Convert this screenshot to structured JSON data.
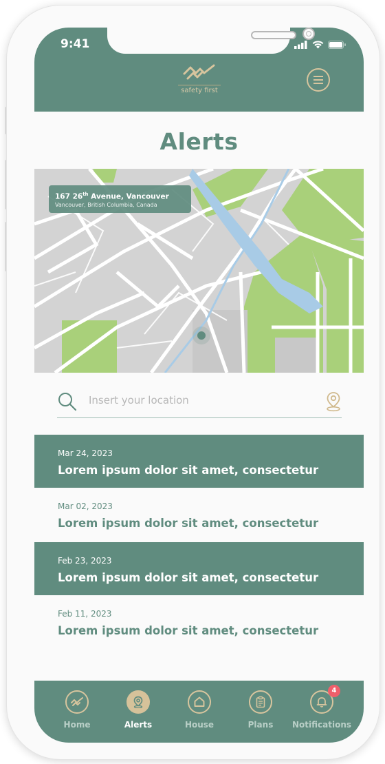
{
  "status_bar": {
    "time": "9:41"
  },
  "header": {
    "logo_text": "safety first"
  },
  "page": {
    "title": "Alerts"
  },
  "map": {
    "address_line1": "167 26",
    "address_sup": "th",
    "address_line1_rest": " Avenue, Vancouver",
    "address_line2": "Vancouver, British Columbia, Canada"
  },
  "search": {
    "placeholder": "Insert your location",
    "value": ""
  },
  "alerts": [
    {
      "date": "Mar 24, 2023",
      "title": "Lorem ipsum dolor sit amet, consectetur",
      "style": "dark"
    },
    {
      "date": "Mar 02, 2023",
      "title": "Lorem ipsum dolor sit amet, consectetur",
      "style": "light"
    },
    {
      "date": "Feb 23, 2023",
      "title": "Lorem ipsum dolor sit amet, consectetur",
      "style": "dark"
    },
    {
      "date": "Feb 11, 2023",
      "title": "Lorem ipsum dolor sit amet, consectetur",
      "style": "light"
    }
  ],
  "tabs": [
    {
      "label": "Home",
      "icon": "pulse-icon",
      "active": false
    },
    {
      "label": "Alerts",
      "icon": "location-pin-icon",
      "active": true
    },
    {
      "label": "House",
      "icon": "house-icon",
      "active": false
    },
    {
      "label": "Plans",
      "icon": "clipboard-icon",
      "active": false
    },
    {
      "label": "Notifications",
      "icon": "bell-icon",
      "active": false,
      "badge": "4"
    }
  ],
  "colors": {
    "primary": "#608c7f",
    "accent": "#d8c59e",
    "map_green": "#a9d07a",
    "map_water": "#a8cbe6",
    "badge": "#ef5f6b"
  }
}
